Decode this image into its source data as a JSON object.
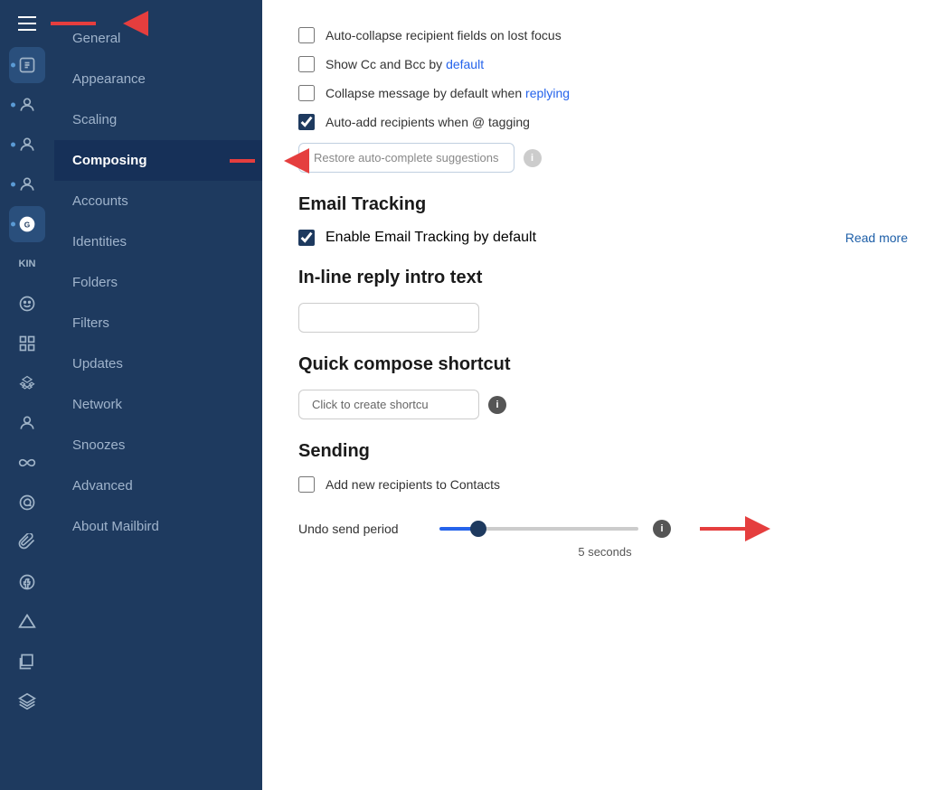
{
  "sidebar": {
    "hamburger_label": "Menu",
    "items": [
      {
        "id": "general",
        "label": "General",
        "active": false,
        "has_dot": false
      },
      {
        "id": "appearance",
        "label": "Appearance",
        "active": false,
        "has_dot": false
      },
      {
        "id": "scaling",
        "label": "Scaling",
        "active": false,
        "has_dot": false
      },
      {
        "id": "composing",
        "label": "Composing",
        "active": true,
        "has_dot": false
      },
      {
        "id": "accounts",
        "label": "Accounts",
        "active": false,
        "has_dot": false
      },
      {
        "id": "identities",
        "label": "Identities",
        "active": false,
        "has_dot": false
      },
      {
        "id": "folders",
        "label": "Folders",
        "active": false,
        "has_dot": false
      },
      {
        "id": "filters",
        "label": "Filters",
        "active": false,
        "has_dot": false
      },
      {
        "id": "updates",
        "label": "Updates",
        "active": false,
        "has_dot": false
      },
      {
        "id": "network",
        "label": "Network",
        "active": false,
        "has_dot": false
      },
      {
        "id": "snoozes",
        "label": "Snoozes",
        "active": false,
        "has_dot": false
      },
      {
        "id": "advanced",
        "label": "Advanced",
        "active": false,
        "has_dot": false
      },
      {
        "id": "about",
        "label": "About Mailbird",
        "active": false,
        "has_dot": false
      }
    ]
  },
  "main": {
    "checkboxes": [
      {
        "id": "auto_collapse",
        "label": "Auto-collapse recipient fields on lost focus",
        "checked": false
      },
      {
        "id": "show_cc_bcc",
        "label": "Show Cc and Bcc by ",
        "link_text": "default",
        "checked": false
      },
      {
        "id": "collapse_reply",
        "label": "Collapse message by default when replying",
        "checked": false
      },
      {
        "id": "auto_add_recipients",
        "label": "Auto-add recipients when @ tagging",
        "checked": true
      }
    ],
    "restore_btn_label": "Restore auto-complete suggestions",
    "email_tracking": {
      "title": "Email Tracking",
      "checkbox_label": "Enable Email Tracking by default",
      "checked": true,
      "read_more": "Read more"
    },
    "inline_reply": {
      "title": "In-line reply intro text",
      "placeholder": ""
    },
    "quick_compose": {
      "title": "Quick compose shortcut",
      "placeholder": "Click to create shortcu"
    },
    "sending": {
      "title": "Sending",
      "add_recipients_label": "Add new recipients to Contacts",
      "add_recipients_checked": false,
      "undo_period_label": "Undo send period",
      "undo_value": 5,
      "undo_display": "5 seconds"
    }
  }
}
